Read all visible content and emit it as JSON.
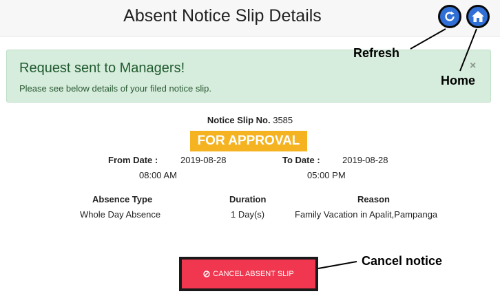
{
  "header": {
    "title": "Absent Notice Slip Details"
  },
  "alert": {
    "heading": "Request sent to Managers!",
    "text": "Please see below details of your filed notice slip.",
    "close": "×"
  },
  "annotations": {
    "refresh": "Refresh",
    "home": "Home",
    "cancel": "Cancel notice"
  },
  "slip": {
    "number_label": "Notice Slip No.",
    "number": "3585",
    "status": "FOR APPROVAL",
    "from_label": "From Date :",
    "from_date": "2019-08-28",
    "from_time": "08:00 AM",
    "to_label": "To Date :",
    "to_date": "2019-08-28",
    "to_time": "05:00 PM",
    "absence_type_label": "Absence Type",
    "absence_type": "Whole Day Absence",
    "duration_label": "Duration",
    "duration": "1 Day(s)",
    "reason_label": "Reason",
    "reason": "Family Vacation in Apalit,Pampanga"
  },
  "actions": {
    "cancel_label": "CANCEL ABSENT SLIP"
  },
  "colors": {
    "accent": "#2f6fd6",
    "status": "#f5b321",
    "danger": "#f0374f",
    "success_bg": "#d6ecdc"
  }
}
